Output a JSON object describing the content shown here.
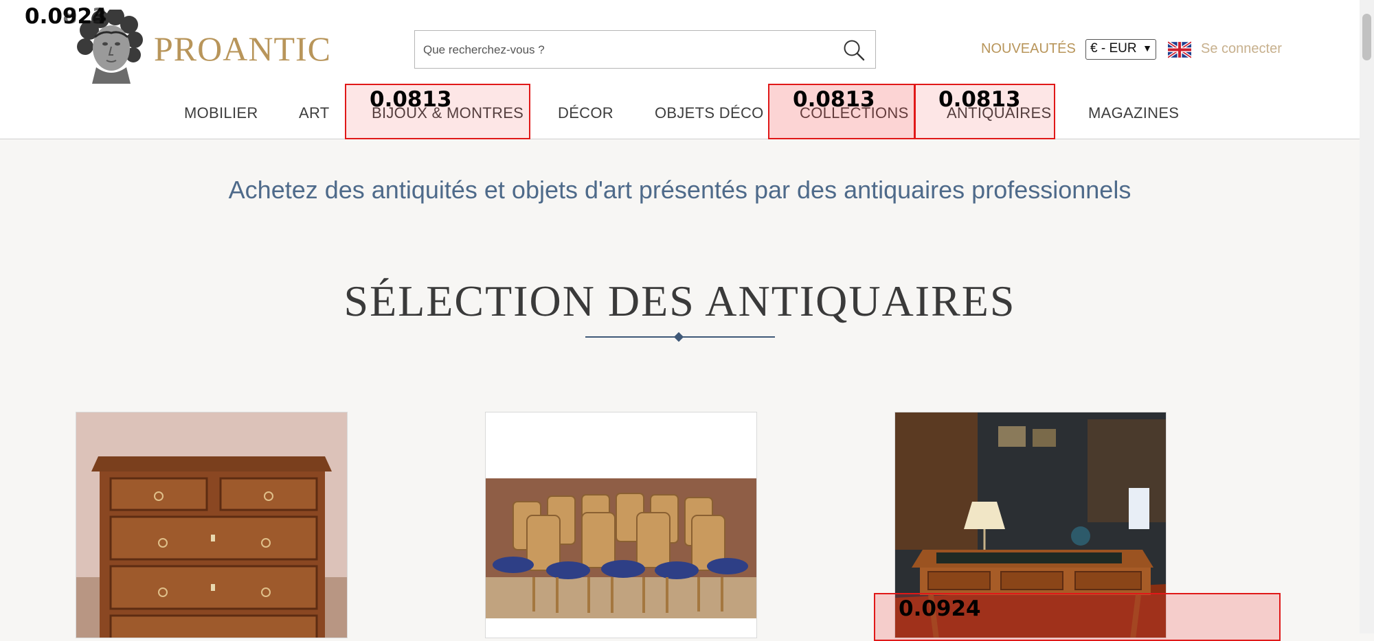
{
  "header": {
    "brand": "PROANTIC",
    "search": {
      "placeholder": "Que recherchez-vous ?"
    },
    "nouveautes_label": "NOUVEAUTÉS",
    "currency": {
      "selected": "€ - EUR"
    },
    "login_label": "Se connecter"
  },
  "nav": {
    "items": [
      {
        "label": "MOBILIER"
      },
      {
        "label": "ART"
      },
      {
        "label": "BIJOUX & MONTRES"
      },
      {
        "label": "DÉCOR"
      },
      {
        "label": "OBJETS DÉCO"
      },
      {
        "label": "COLLECTIONS"
      },
      {
        "label": "ANTIQUAIRES"
      },
      {
        "label": "MAGAZINES"
      }
    ]
  },
  "main": {
    "tagline": "Achetez des antiquités et objets d'art présentés par des antiquaires professionnels",
    "section_title": "SÉLECTION DES ANTIQUAIRES",
    "cards": [
      {
        "subject": "walnut chest of drawers"
      },
      {
        "subject": "set of cane chairs with blue cushions"
      },
      {
        "subject": "Louis XVI style writing desk"
      }
    ]
  },
  "overlay": {
    "scores": {
      "logo_a": "0.0924",
      "logo_b": "0.0823",
      "bijoux": "0.0813",
      "collections": "0.0813",
      "antiquaires": "0.0813",
      "card3": "0.0924"
    }
  },
  "colors": {
    "accent_gold": "#b8955a",
    "tagline_blue": "#4e6a8a",
    "highlight_red": "#e01818"
  }
}
